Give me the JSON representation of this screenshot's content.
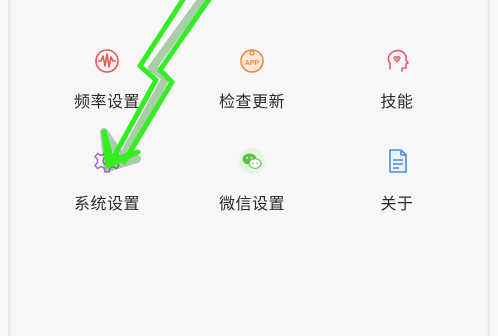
{
  "menu": {
    "row1": [
      {
        "label": "频率设置",
        "icon": "frequency-icon",
        "color": "#e8584f"
      },
      {
        "label": "检查更新",
        "icon": "app-update-icon",
        "color": "#f08a3c"
      },
      {
        "label": "技能",
        "icon": "skill-head-icon",
        "color": "#e8586a"
      }
    ],
    "row2": [
      {
        "label": "系统设置",
        "icon": "gear-icon",
        "color": "#b06ad8"
      },
      {
        "label": "微信设置",
        "icon": "wechat-icon",
        "color": "#5bbf4a"
      },
      {
        "label": "关于",
        "icon": "document-icon",
        "color": "#4a8fd8"
      }
    ]
  },
  "annotation": {
    "icon": "arrow-annotation",
    "color": "#33ee22"
  }
}
